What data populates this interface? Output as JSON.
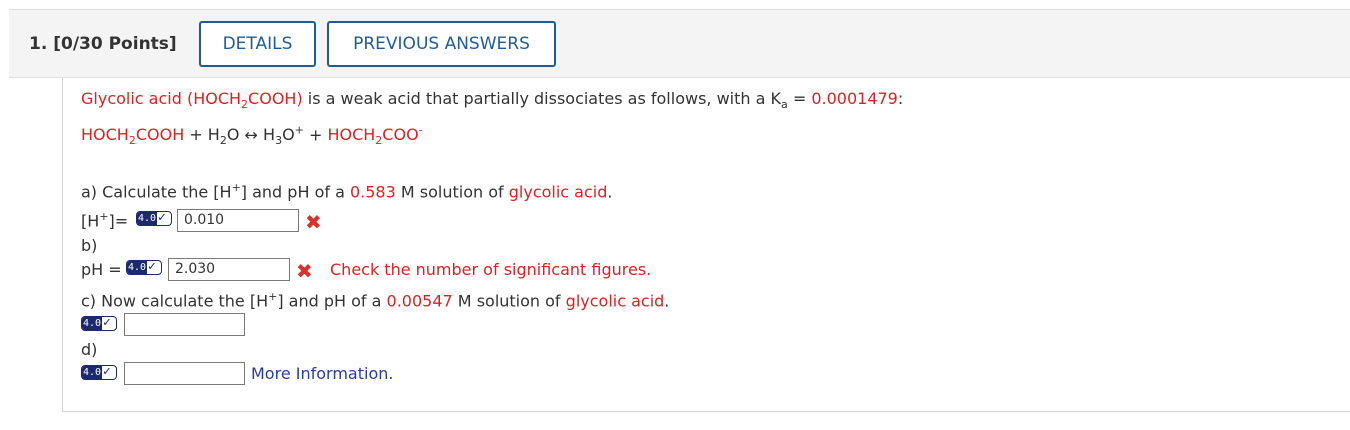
{
  "question": {
    "number_label": "1.",
    "points_label": "[0/30 Points]",
    "details_button": "DETAILS",
    "previous_answers_button": "PREVIOUS ANSWERS"
  },
  "intro": {
    "acid_name": "Glycolic acid",
    "formula_open": "(HOCH",
    "formula_sub": "2",
    "formula_close": "COOH)",
    "desc": "is a weak acid that partially dissociates as follows, with a K",
    "ka_sub": "a",
    "equals": "=",
    "ka_value": "0.0001479",
    "colon": ":"
  },
  "equation": {
    "reactant1_a": "HOCH",
    "reactant1_sub": "2",
    "reactant1_b": "COOH",
    "plus1": "+ H",
    "water_sub": "2",
    "water_o": "O",
    "arrow": "↔",
    "hydronium_a": "H",
    "hydronium_sub": "3",
    "hydronium_o": "O",
    "hydronium_sup": "+",
    "plus2": "+",
    "product_a": "HOCH",
    "product_sub": "2",
    "product_b": "COO",
    "product_sup": "-"
  },
  "part_a": {
    "prefix": "a) Calculate the [H",
    "sup": "+",
    "middle": "] and pH of a",
    "conc": "0.583",
    "unit": "M solution of",
    "acid": "glycolic acid",
    "period": "."
  },
  "h_label": {
    "open": "[H",
    "sup": "+",
    "close": "]="
  },
  "answer_h": {
    "value": "0.010",
    "status": "incorrect"
  },
  "part_b_label": "b)",
  "ph_label": "pH =",
  "answer_ph": {
    "value": "2.030",
    "status": "incorrect",
    "feedback": "Check the number of significant figures."
  },
  "part_c": {
    "prefix": "c) Now calculate the [H",
    "sup": "+",
    "middle": "] and pH of a",
    "conc": "0.00547",
    "unit": "M solution of",
    "acid": "glycolic acid",
    "period": "."
  },
  "answer_c": {
    "value": ""
  },
  "part_d_label": "d)",
  "answer_d": {
    "value": ""
  },
  "more_info": "More Information.",
  "badge": {
    "number": "4.0",
    "check": "✓"
  },
  "colors": {
    "accent": "#1f5c99",
    "highlight": "#e02020",
    "error": "#d9342b",
    "link": "#2a3bab"
  }
}
